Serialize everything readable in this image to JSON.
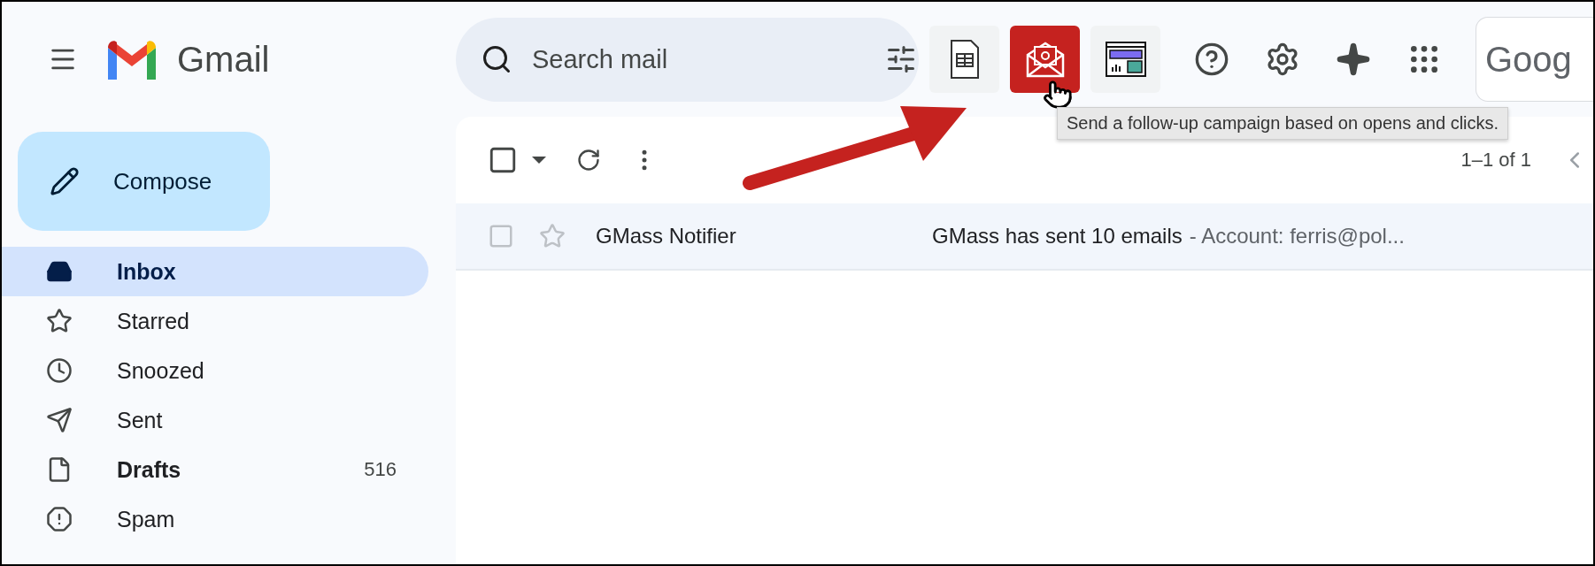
{
  "header": {
    "logo_text": "Gmail",
    "search": {
      "placeholder": "Search mail"
    },
    "addon_buttons": [
      {
        "kind": "sheet",
        "selected": false
      },
      {
        "kind": "campaign",
        "selected": true
      },
      {
        "kind": "dashboard",
        "selected": false
      }
    ],
    "account_text": "Goog"
  },
  "tooltip": "Send a follow-up campaign based on opens and clicks.",
  "compose": "Compose",
  "sidebar": {
    "items": [
      {
        "kind": "inbox",
        "label": "Inbox",
        "selected": true,
        "bold": true
      },
      {
        "kind": "starred",
        "label": "Starred",
        "selected": false,
        "bold": false
      },
      {
        "kind": "snoozed",
        "label": "Snoozed",
        "selected": false,
        "bold": false
      },
      {
        "kind": "sent",
        "label": "Sent",
        "selected": false,
        "bold": false
      },
      {
        "kind": "drafts",
        "label": "Drafts",
        "count": "516",
        "selected": false,
        "bold": true
      },
      {
        "kind": "spam",
        "label": "Spam",
        "selected": false,
        "bold": false
      }
    ]
  },
  "toolbar": {
    "checked": false,
    "pagination": "1–1 of 1"
  },
  "emails": [
    {
      "sender": "GMass Notifier",
      "subject": "GMass has sent 10 emails",
      "snippet": "- Account: ferris@pol...",
      "starred": false,
      "checked": false
    }
  ]
}
